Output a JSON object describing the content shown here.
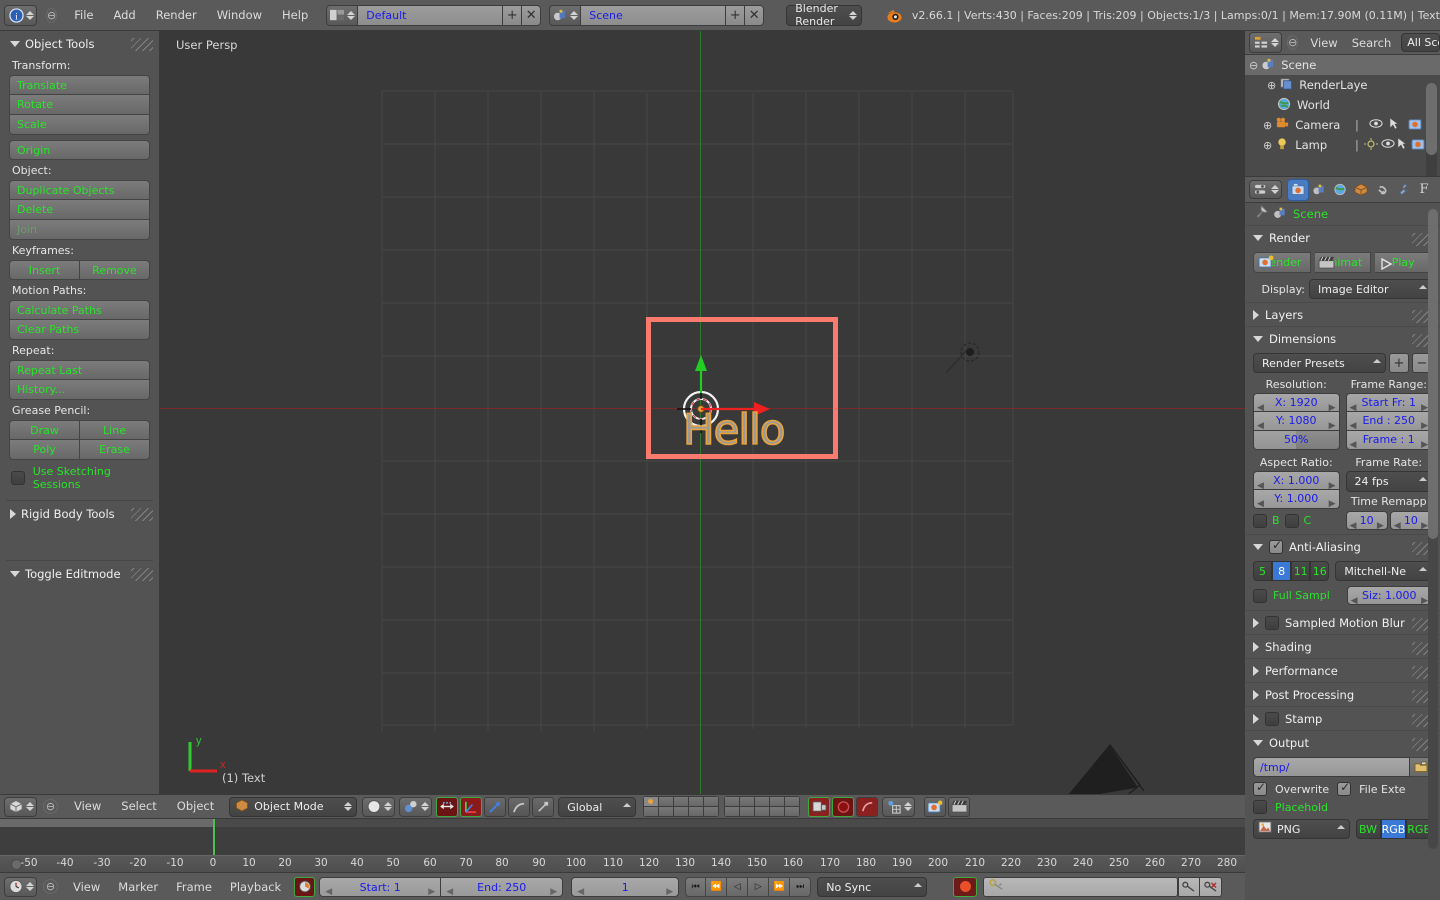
{
  "topbar": {
    "editor_icon": "info-editor-icon",
    "collapse_icon": "collapse-menu-icon",
    "menus": [
      "File",
      "Add",
      "Render",
      "Window",
      "Help"
    ],
    "screen_layout": {
      "icon": "screen-layout-icon",
      "value": "Default",
      "add_label": "+",
      "remove_label": "✕"
    },
    "scene_selector": {
      "icon": "scene-data-icon",
      "value": "Scene",
      "add_label": "+",
      "remove_label": "✕"
    },
    "render_engine": "Blender Render",
    "logo_icon": "blender-logo-icon",
    "status": "v2.66.1 | Verts:430 | Faces:209 | Tris:209 | Objects:1/3 | Lamps:0/1 | Mem:17.90M (0.11M) | Text"
  },
  "toolshelf": {
    "title": "Object Tools",
    "sections": [
      {
        "label": "Transform:",
        "buttons": [
          "Translate",
          "Rotate",
          "Scale"
        ]
      },
      {
        "label": "",
        "buttons": [
          "Origin"
        ]
      },
      {
        "label": "Object:",
        "buttons": [
          "Duplicate Objects",
          "Delete",
          "Join"
        ]
      },
      {
        "label": "Keyframes:",
        "row": [
          "Insert",
          "Remove"
        ]
      },
      {
        "label": "Motion Paths:",
        "buttons": [
          "Calculate Paths",
          "Clear Paths"
        ]
      },
      {
        "label": "Repeat:",
        "buttons": [
          "Repeat Last",
          "History..."
        ]
      },
      {
        "label": "Grease Pencil:",
        "grid": [
          "Draw",
          "Line",
          "Poly",
          "Erase"
        ]
      }
    ],
    "sketching_checkbox": {
      "label": "Use Sketching Sessions",
      "checked": false
    },
    "rigid_body_tools": "Rigid Body Tools",
    "toggle_editmode": "Toggle Editmode"
  },
  "viewport": {
    "perspective_label": "User Persp",
    "object_label": "(1) Text",
    "axis_x": "x",
    "axis_y": "y",
    "text_object": "Hello",
    "camera_border_color": "#fa7a6e",
    "text_outline_color": "#e8a33d",
    "grid_color": "#4a4a4a",
    "background_color": "#393939"
  },
  "outliner": {
    "editor_icon": "outliner-editor-icon",
    "collapse_icon": "collapse-menu-icon",
    "menus": [
      "View",
      "Search"
    ],
    "filter": "All Sce",
    "rows": [
      {
        "name": "Scene",
        "icon": "scene-icon",
        "indent": 0,
        "expander": "minus",
        "selected": true
      },
      {
        "name": "RenderLaye",
        "icon": "renderlayer-icon",
        "indent": 1,
        "expander": "plus",
        "selected": false
      },
      {
        "name": "World",
        "icon": "world-icon",
        "indent": 1,
        "expander": "none",
        "selected": false
      },
      {
        "name": "Camera",
        "icon": "camera-icon",
        "indent": 1,
        "expander": "plus",
        "selected": false
      },
      {
        "name": "Lamp",
        "icon": "lamp-icon",
        "indent": 1,
        "expander": "plus",
        "selected": false
      }
    ]
  },
  "properties": {
    "tabs": [
      {
        "name": "render-tab",
        "glyph": "▣",
        "active": true
      },
      {
        "name": "scene-tab",
        "glyph": "◑",
        "active": false
      },
      {
        "name": "world-tab",
        "glyph": "◉",
        "active": false
      },
      {
        "name": "object-tab",
        "glyph": "▨",
        "active": false
      },
      {
        "name": "physics-tab",
        "glyph": "⛓",
        "active": false
      },
      {
        "name": "modifier-tab",
        "glyph": "🔧",
        "active": false
      },
      {
        "name": "font-tab",
        "glyph": "F",
        "active": false
      }
    ],
    "breadcrumb": {
      "pin_icon": "pin-icon",
      "scene_icon": "scene-data-icon",
      "label": "Scene"
    },
    "render": {
      "title": "Render",
      "buttons": [
        "Render",
        "Animat",
        "Play"
      ],
      "display_label": "Display:",
      "display_value": "Image Editor"
    },
    "layers": {
      "title": "Layers"
    },
    "dimensions": {
      "title": "Dimensions",
      "preset": "Render Presets",
      "preset_add": "+",
      "preset_remove": "−",
      "resolution_label": "Resolution:",
      "resolution_x": "X: 1920",
      "resolution_y": "Y: 1080",
      "resolution_pct": "50%",
      "frame_range_label": "Frame Range:",
      "frame_start": "Start Fr: 1",
      "frame_end": "End : 250",
      "frame_current": "Frame : 1",
      "aspect_label": "Aspect Ratio:",
      "aspect_x": "X: 1.000",
      "aspect_y": "Y: 1.000",
      "frame_rate_label": "Frame Rate:",
      "frame_rate": "24 fps",
      "time_remap_label": "Time Remapp",
      "time_remap_old": "10",
      "time_remap_new": "10",
      "border_b": "B",
      "border_c": "C"
    },
    "antialiasing": {
      "title": "Anti-Aliasing",
      "checked": true,
      "samples": [
        "5",
        "8",
        "11",
        "16"
      ],
      "samples_active": "8",
      "filter": "Mitchell-Ne",
      "full_sample_label": "Full Sampl",
      "full_sample_checked": false,
      "size": "Siz: 1.000"
    },
    "collapsed": [
      {
        "title": "Sampled Motion Blur",
        "checkbox": true
      },
      {
        "title": "Shading",
        "checkbox": false
      },
      {
        "title": "Performance",
        "checkbox": false
      },
      {
        "title": "Post Processing",
        "checkbox": false
      },
      {
        "title": "Stamp",
        "checkbox": true
      }
    ],
    "output": {
      "title": "Output",
      "path": "/tmp/",
      "folder_icon": "folder-icon",
      "overwrite_label": "Overwrite",
      "overwrite_checked": true,
      "file_ext_label": "File Exte",
      "file_ext_checked": true,
      "placeholder_label": "Placehold",
      "placeholder_checked": false,
      "format": "PNG",
      "format_icon": "image-file-icon",
      "color_modes": [
        "BW",
        "RGB",
        "RGB"
      ],
      "color_mode_active": "RGB"
    }
  },
  "vpfooter": {
    "editor_icon": "3d-view-editor-icon",
    "collapse_icon": "collapse-menu-icon",
    "menus": [
      "View",
      "Select",
      "Object"
    ],
    "mode": {
      "icon": "object-mode-icon",
      "value": "Object Mode"
    },
    "shading": {
      "icon": "solid-shading-icon"
    },
    "pivot": {
      "icon": "pivot-point-icon"
    },
    "manipulator_toggle": {
      "icon": "manipulator-icon",
      "active": true
    },
    "manipulator_modes": [
      {
        "icon": "translate-manipulator-icon",
        "active": true
      },
      {
        "icon": "rotate-manipulator-icon",
        "active": false
      },
      {
        "icon": "scale-manipulator-icon",
        "active": false
      }
    ],
    "orientation": "Global",
    "layers": {
      "first_layer_active": true
    },
    "extra": [
      {
        "icon": "lock-object-modes-icon",
        "active": true
      },
      {
        "icon": "render-preview-icon",
        "active": true
      },
      {
        "icon": "proportional-edit-icon",
        "active": true
      },
      {
        "icon": "snap-icon",
        "active": false
      },
      {
        "icon": "render-camera-icon",
        "active": false
      },
      {
        "icon": "render-animation-icon",
        "active": false
      }
    ]
  },
  "timeline": {
    "editor_icon": "timeline-editor-icon",
    "collapse_icon": "collapse-menu-icon",
    "menus": [
      "View",
      "Marker",
      "Frame",
      "Playback"
    ],
    "autokey_icon": "auto-keyframe-icon",
    "start_label": "Start: 1",
    "end_label": "End: 250",
    "current_frame": "1",
    "nav_buttons": [
      "⏮",
      "⏪",
      "◁",
      "▷",
      "⏩",
      "⏭"
    ],
    "sync_mode": "No Sync",
    "record_icon": "record-icon",
    "key_field_icon": "keying-set-icon",
    "key_add_icon": "add-keyframe-icon",
    "key_remove_icon": "remove-keyframe-icon",
    "ruler_ticks": [
      "-50",
      "-40",
      "-30",
      "-20",
      "-10",
      "0",
      "10",
      "20",
      "30",
      "40",
      "50",
      "60",
      "70",
      "80",
      "90",
      "100",
      "110",
      "120",
      "130",
      "140",
      "150",
      "160",
      "170",
      "180",
      "190",
      "200",
      "210",
      "220",
      "230",
      "240",
      "250",
      "260",
      "270",
      "280"
    ]
  }
}
